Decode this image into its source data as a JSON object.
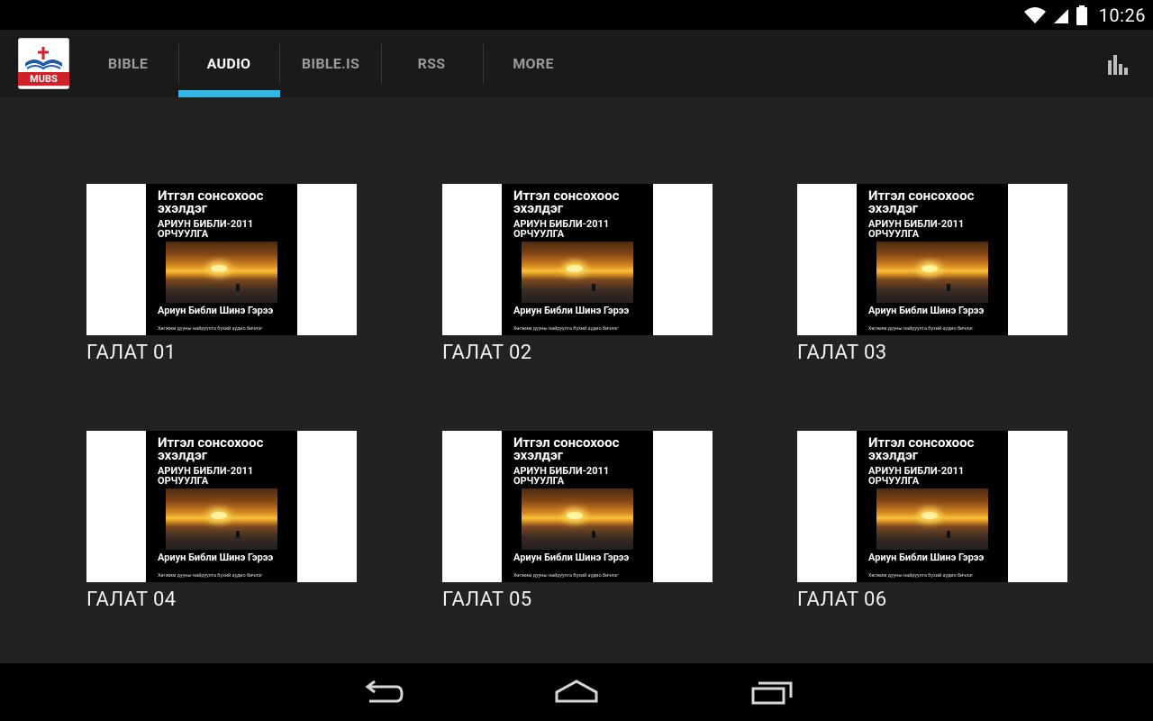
{
  "status_bar": {
    "time": "10:26",
    "icons": [
      "wifi-icon",
      "cell-signal-icon",
      "battery-icon"
    ]
  },
  "app": {
    "logo_text": "MUBS",
    "tabs": [
      {
        "label": "BIBLE",
        "active": false
      },
      {
        "label": "AUDIO",
        "active": true
      },
      {
        "label": "BIBLE.IS",
        "active": false
      },
      {
        "label": "RSS",
        "active": false
      },
      {
        "label": "MORE",
        "active": false
      }
    ],
    "accent_color": "#33b5e5"
  },
  "cover": {
    "title": "Итгэл сонсохоос эхэлдэг",
    "subtitle": "АРИУН БИБЛИ-2011 ОРЧУУЛГА",
    "bottom_title": "Ариун Библи Шинэ Гэрээ",
    "tagline": "Хөгжим дууны найруулга бүхий аудио бичлэг"
  },
  "tracks": [
    {
      "label": "ГАЛАТ 01"
    },
    {
      "label": "ГАЛАТ 02"
    },
    {
      "label": "ГАЛАТ 03"
    },
    {
      "label": "ГАЛАТ 04"
    },
    {
      "label": "ГАЛАТ 05"
    },
    {
      "label": "ГАЛАТ 06"
    }
  ],
  "nav_bar": {
    "buttons": [
      "back-icon",
      "home-icon",
      "recent-apps-icon"
    ]
  }
}
